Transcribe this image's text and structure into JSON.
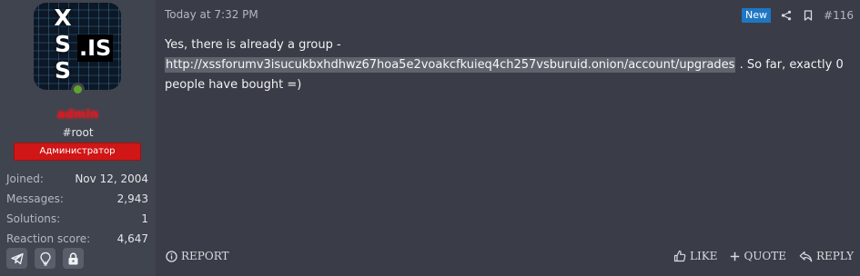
{
  "user": {
    "avatar_letters": [
      "X",
      "S",
      "S"
    ],
    "avatar_suffix": ".IS",
    "name": "admin",
    "title": "#root",
    "role": "Администратор",
    "stats": [
      {
        "key": "Joined:",
        "value": "Nov 12, 2004"
      },
      {
        "key": "Messages:",
        "value": "2,943"
      },
      {
        "key": "Solutions:",
        "value": "1"
      },
      {
        "key": "Reaction score:",
        "value": "4,647"
      }
    ],
    "contact_icons": [
      "telegram-icon",
      "lightbulb-icon",
      "lock-icon"
    ]
  },
  "post": {
    "timestamp": "Today at 7:32 PM",
    "badge": "New",
    "number": "#116",
    "text_before": "Yes, there is already a group - ",
    "link": "http://xssforumv3isucukbxhdhwz67hoa5e2voakcfkuieq4ch257vsburuid.onion/account/upgrades",
    "text_after": " . So far, exactly 0 people have bought =)"
  },
  "actions": {
    "report": "REPORT",
    "like": "LIKE",
    "quote": "QUOTE",
    "reply": "REPLY"
  },
  "colors": {
    "username": "#e0161e",
    "role_banner": "#d01616",
    "new_badge": "#1e76c4",
    "online": "#5fa52c"
  }
}
